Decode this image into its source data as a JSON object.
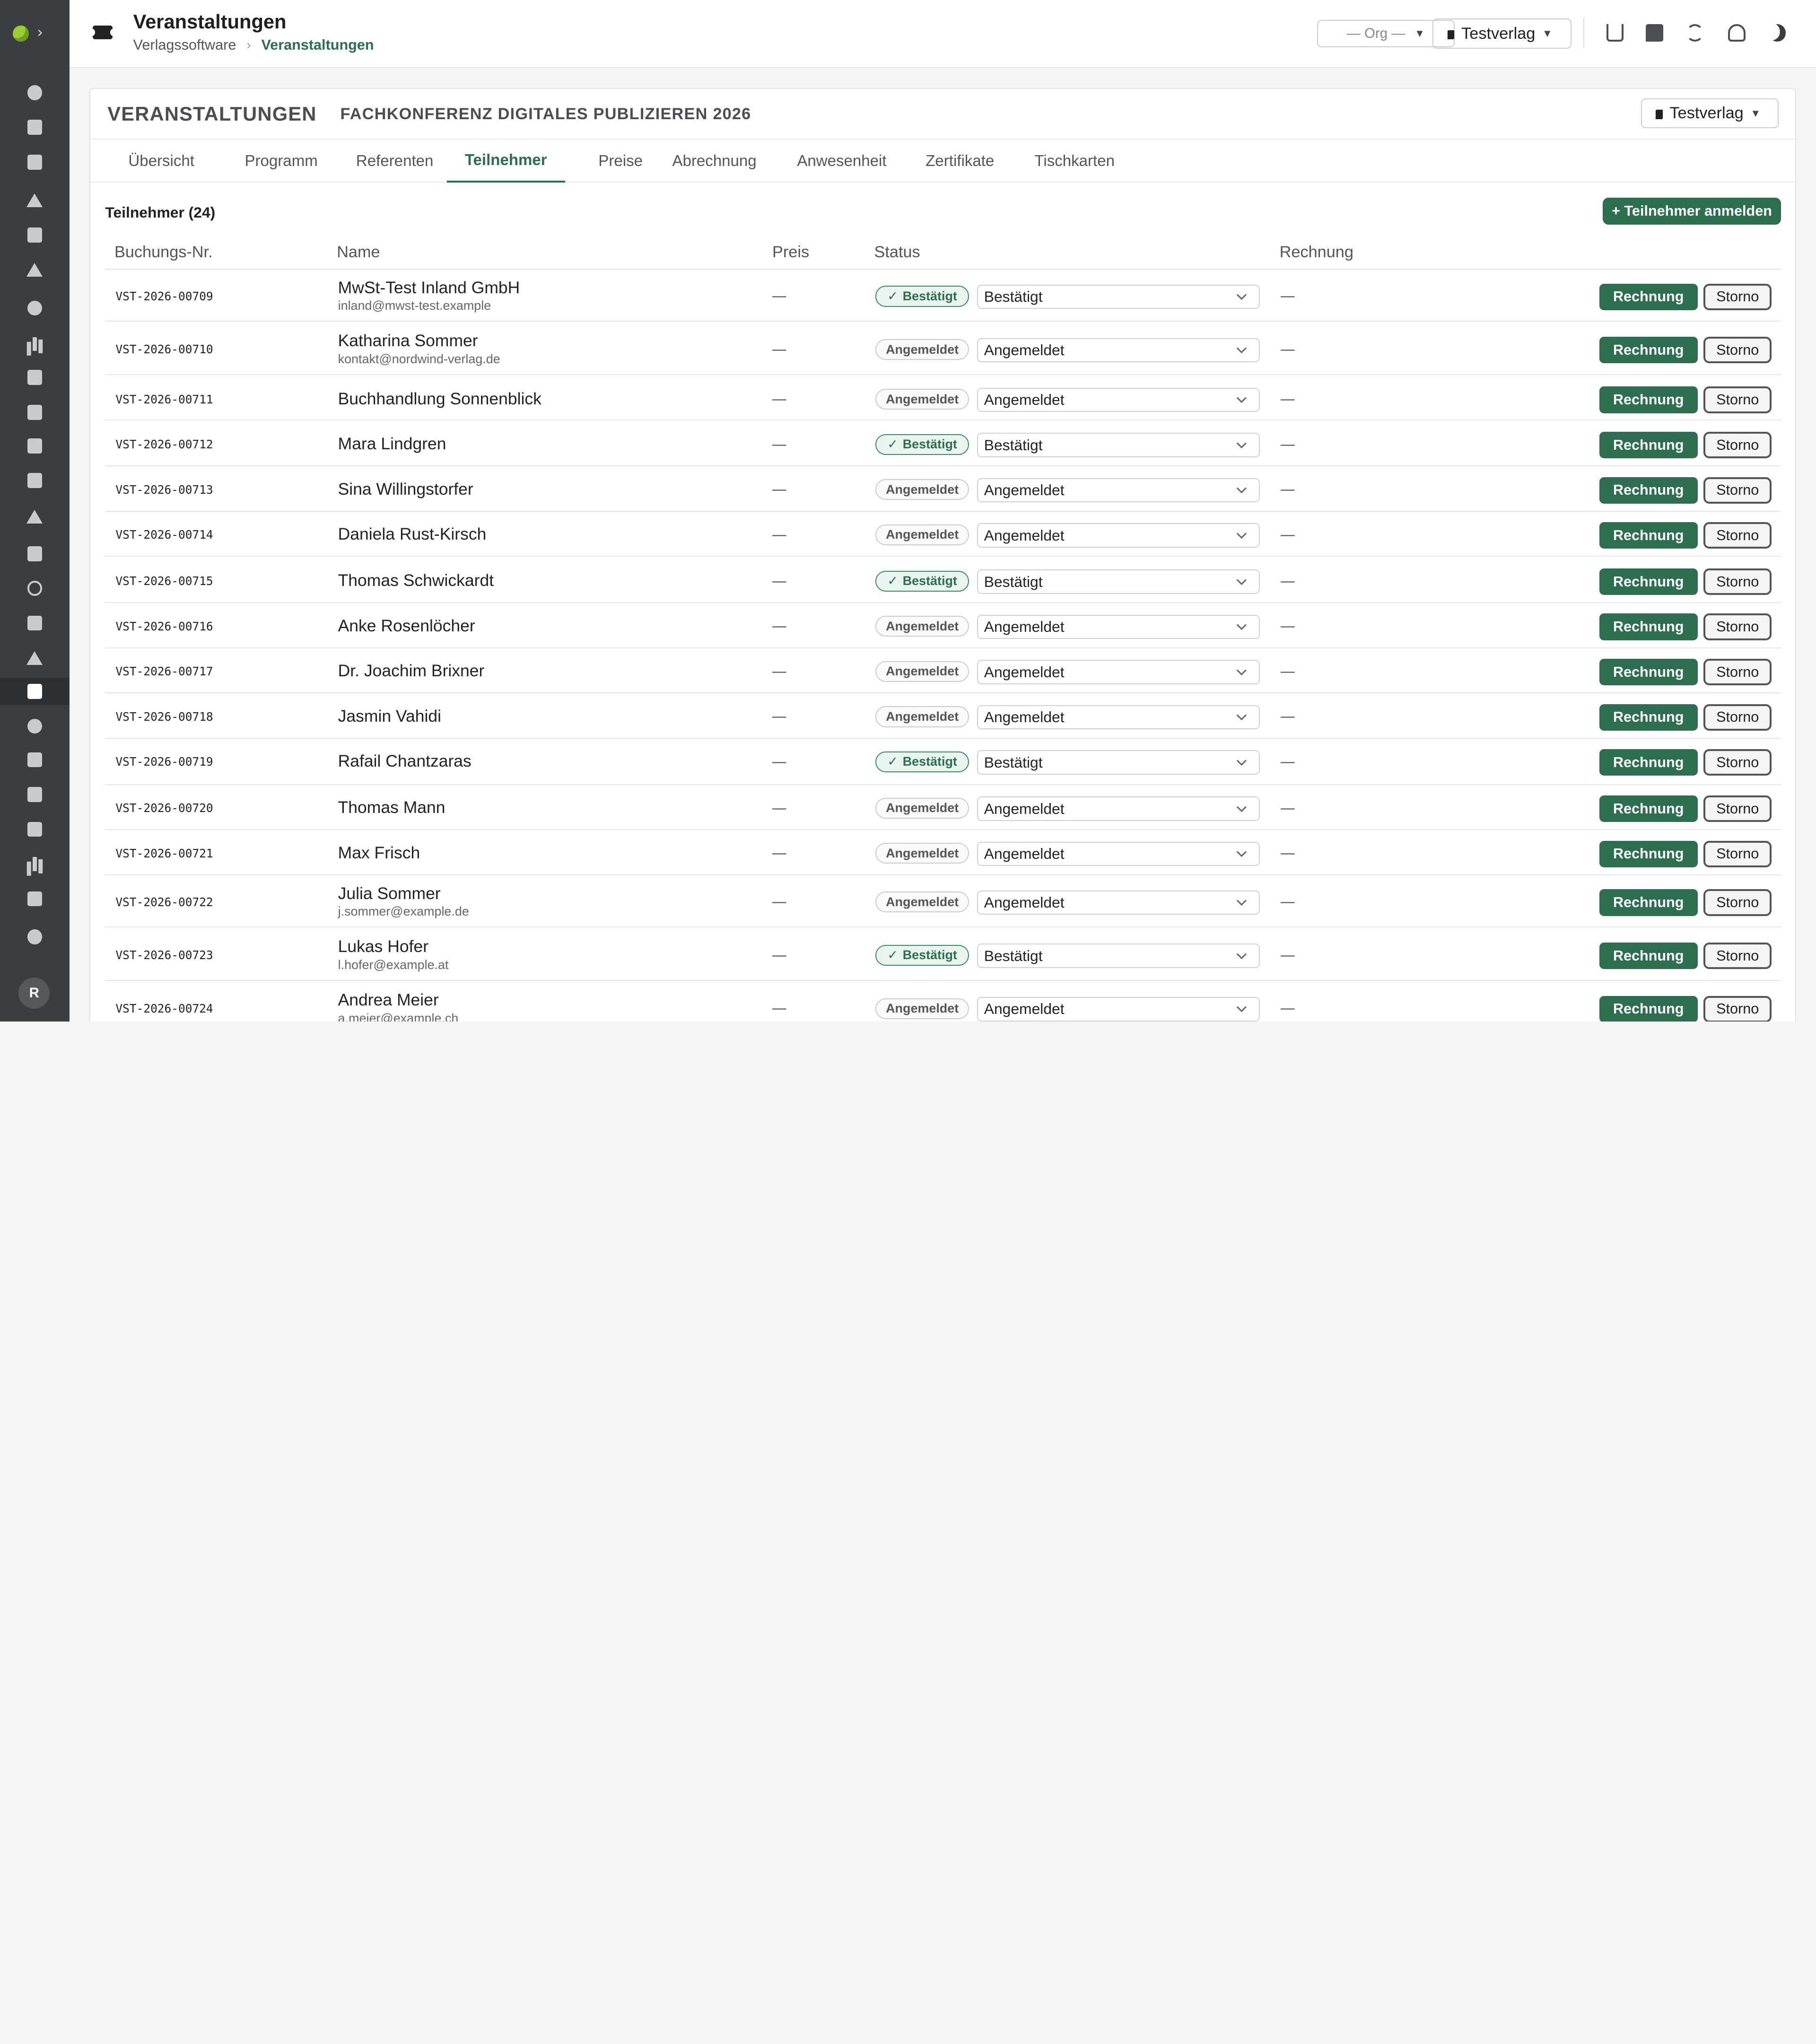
{
  "header": {
    "title": "Veranstaltungen",
    "breadcrumb": [
      "Verlagssoftware",
      "Veranstaltungen"
    ],
    "org_select": "— Org —",
    "verlag_select": "Testverlag"
  },
  "card": {
    "title": "VERANSTALTUNGEN",
    "subtitle": "FACHKONFERENZ DIGITALES PUBLIZIEREN 2026",
    "verlag_select": "Testverlag"
  },
  "tabs": [
    "Übersicht",
    "Programm",
    "Referenten",
    "Teilnehmer",
    "Preise",
    "Abrechnung",
    "Anwesenheit",
    "Zertifikate",
    "Tischkarten"
  ],
  "active_tab": "Teilnehmer",
  "participants": {
    "count_label": "Teilnehmer (24)",
    "add_button": "+ Teilnehmer anmelden"
  },
  "columns": [
    "Buchungs-Nr.",
    "Name",
    "Preis",
    "Status",
    "Rechnung"
  ],
  "labels": {
    "invoice_button": "Rechnung",
    "cancel_button": "Storno",
    "dash": "—"
  },
  "rows": [
    {
      "nr": "VST-2026-00709",
      "name": "MwSt-Test Inland GmbH",
      "email": "inland@mwst-test.example",
      "badge": "Bestätigt",
      "status": "Bestätigt"
    },
    {
      "nr": "VST-2026-00710",
      "name": "Katharina Sommer",
      "email": "kontakt@nordwind-verlag.de",
      "badge": "Angemeldet",
      "status": "Angemeldet"
    },
    {
      "nr": "VST-2026-00711",
      "name": "Buchhandlung Sonnenblick",
      "email": "",
      "badge": "Angemeldet",
      "status": "Angemeldet"
    },
    {
      "nr": "VST-2026-00712",
      "name": "Mara Lindgren",
      "email": "",
      "badge": "Bestätigt",
      "status": "Bestätigt"
    },
    {
      "nr": "VST-2026-00713",
      "name": "Sina Willingstorfer",
      "email": "",
      "badge": "Angemeldet",
      "status": "Angemeldet"
    },
    {
      "nr": "VST-2026-00714",
      "name": "Daniela Rust-Kirsch",
      "email": "",
      "badge": "Angemeldet",
      "status": "Angemeldet"
    },
    {
      "nr": "VST-2026-00715",
      "name": "Thomas Schwickardt",
      "email": "",
      "badge": "Bestätigt",
      "status": "Bestätigt"
    },
    {
      "nr": "VST-2026-00716",
      "name": "Anke Rosenlöcher",
      "email": "",
      "badge": "Angemeldet",
      "status": "Angemeldet"
    },
    {
      "nr": "VST-2026-00717",
      "name": "Dr. Joachim Brixner",
      "email": "",
      "badge": "Angemeldet",
      "status": "Angemeldet"
    },
    {
      "nr": "VST-2026-00718",
      "name": "Jasmin Vahidi",
      "email": "",
      "badge": "Angemeldet",
      "status": "Angemeldet"
    },
    {
      "nr": "VST-2026-00719",
      "name": "Rafail Chantzaras",
      "email": "",
      "badge": "Bestätigt",
      "status": "Bestätigt"
    },
    {
      "nr": "VST-2026-00720",
      "name": "Thomas Mann",
      "email": "",
      "badge": "Angemeldet",
      "status": "Angemeldet"
    },
    {
      "nr": "VST-2026-00721",
      "name": "Max Frisch",
      "email": "",
      "badge": "Angemeldet",
      "status": "Angemeldet"
    },
    {
      "nr": "VST-2026-00722",
      "name": "Julia Sommer",
      "email": "j.sommer@example.de",
      "badge": "Angemeldet",
      "status": "Angemeldet"
    },
    {
      "nr": "VST-2026-00723",
      "name": "Lukas Hofer",
      "email": "l.hofer@example.at",
      "badge": "Bestätigt",
      "status": "Bestätigt"
    },
    {
      "nr": "VST-2026-00724",
      "name": "Andrea Meier",
      "email": "a.meier@example.ch",
      "badge": "Angemeldet",
      "status": "Angemeldet"
    }
  ],
  "sidebar": {
    "avatar": "R",
    "icons": [
      "dashboard-icon",
      "calendar-icon",
      "grid-icon",
      "edit-user-icon",
      "stack-icon",
      "send-icon",
      "bulb-icon",
      "books-icon",
      "image-icon",
      "briefcase-icon",
      "newspaper-icon",
      "scroll-icon",
      "feather-icon",
      "tray-icon",
      "circle-icon",
      "bag-icon",
      "megaphone-icon",
      "ticket-icon",
      "music-icon",
      "file-icon",
      "store-icon",
      "export-icon",
      "chart-icon",
      "document-icon",
      "shield-icon"
    ]
  },
  "colors": {
    "accent": "#2c6e4f",
    "sidebar": "#3a3d41"
  }
}
